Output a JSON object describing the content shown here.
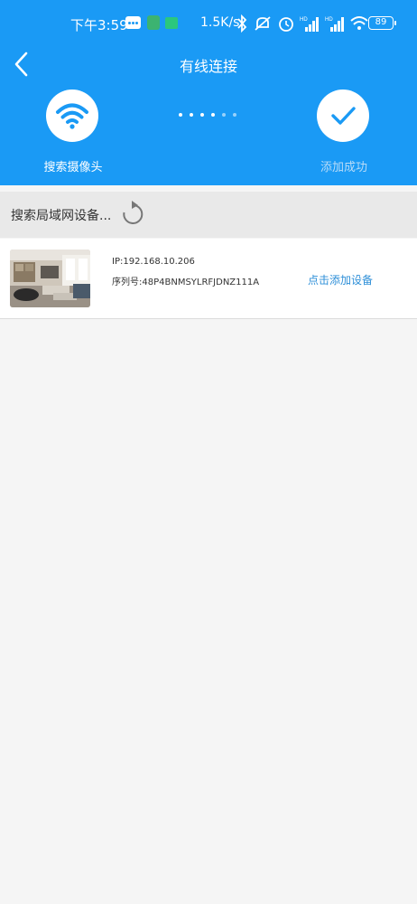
{
  "status_bar": {
    "time": "下午3:59",
    "net_speed": "1.5K/s",
    "battery": "89",
    "icons": [
      "message-icon",
      "app-icon",
      "app-icon",
      "bluetooth-icon",
      "mute-icon",
      "alarm-icon",
      "signal-icon",
      "signal-icon",
      "wifi-icon",
      "battery-icon"
    ]
  },
  "header": {
    "title": "有线连接",
    "back_icon": "back-arrow-icon"
  },
  "steps": [
    {
      "label": "搜索摄像头",
      "icon": "wifi-icon",
      "active": true
    },
    {
      "label": "添加成功",
      "icon": "check-icon",
      "active": false
    }
  ],
  "progress_dots": {
    "total": 6,
    "bright": 4
  },
  "search": {
    "label": "搜索局域网设备...",
    "refresh_icon": "refresh-icon"
  },
  "devices": [
    {
      "ip": "IP:192.168.10.206",
      "serial": "序列号:48P4BNMSYLRFJDNZ111A",
      "action": "点击添加设备"
    }
  ],
  "colors": {
    "header_bg": "#1a9af5",
    "link": "#2e8fd8",
    "page_bg": "#f5f5f5",
    "search_bg": "#e9e9e9"
  }
}
